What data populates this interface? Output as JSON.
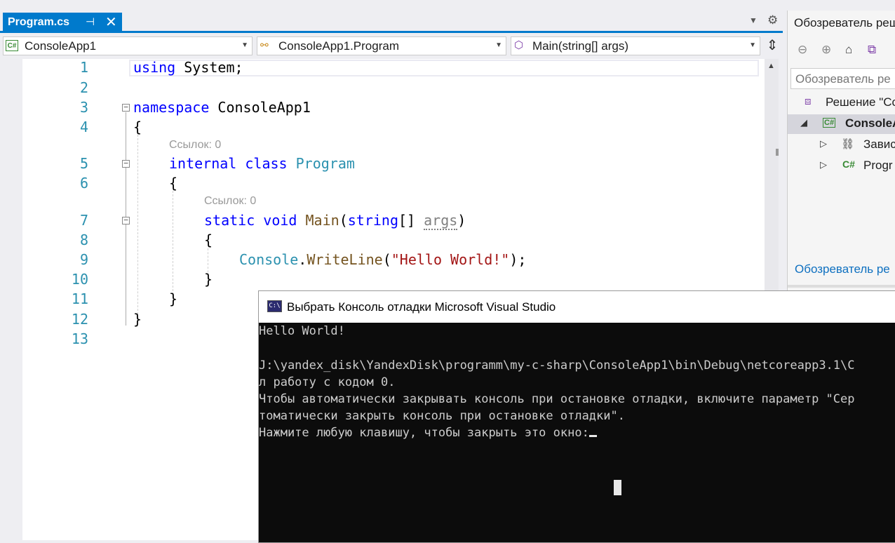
{
  "tab": {
    "title": "Program.cs",
    "pin_glyph": "⊣",
    "close_glyph": "✕"
  },
  "navbar": {
    "project": "ConsoleApp1",
    "type": "ConsoleApp1.Program",
    "member": "Main(string[] args)"
  },
  "editor": {
    "line_numbers": [
      "1",
      "2",
      "3",
      "4",
      "5",
      "6",
      "7",
      "8",
      "9",
      "10",
      "11",
      "12",
      "13"
    ],
    "references_label": "Ссылок: 0",
    "code": {
      "l1_kw": "using",
      "l1_rest": " System;",
      "l3_kw": "namespace",
      "l3_rest": " ConsoleApp1",
      "l4": "{",
      "l5_kw1": "internal",
      "l5_kw2": "class",
      "l5_type": "Program",
      "l6": "{",
      "l7_kw1": "static",
      "l7_kw2": "void",
      "l7_method": "Main",
      "l7_open": "(",
      "l7_kw3": "string",
      "l7_brackets": "[] ",
      "l7_param": "args",
      "l7_close": ")",
      "l8": "{",
      "l9_type": "Console",
      "l9_dot": ".",
      "l9_method": "WriteLine",
      "l9_open": "(",
      "l9_string": "\"Hello World!\"",
      "l9_close": ");",
      "l10": "}",
      "l11": "}",
      "l12": "}"
    }
  },
  "solution_explorer": {
    "title": "Обозреватель реш",
    "search_placeholder": "Обозреватель ре",
    "tree": [
      {
        "label": "Решение \"Co"
      },
      {
        "label": "ConsoleA"
      },
      {
        "label": "Завис"
      },
      {
        "label": "Progr"
      }
    ],
    "link": "Обозреватель ре"
  },
  "console": {
    "title": "Выбрать Консоль отладки Microsoft Visual Studio",
    "icon_text": "C:\\",
    "lines": [
      "Hello World!",
      "",
      "J:\\yandex_disk\\YandexDisk\\programm\\my-c-sharp\\ConsoleApp1\\bin\\Debug\\netcoreapp3.1\\C",
      "л работу с кодом 0.",
      "Чтобы автоматически закрывать консоль при остановке отладки, включите параметр \"Сер",
      "томатически закрыть консоль при остановке отладки\".",
      "Нажмите любую клавишу, чтобы закрыть это окно:"
    ]
  }
}
